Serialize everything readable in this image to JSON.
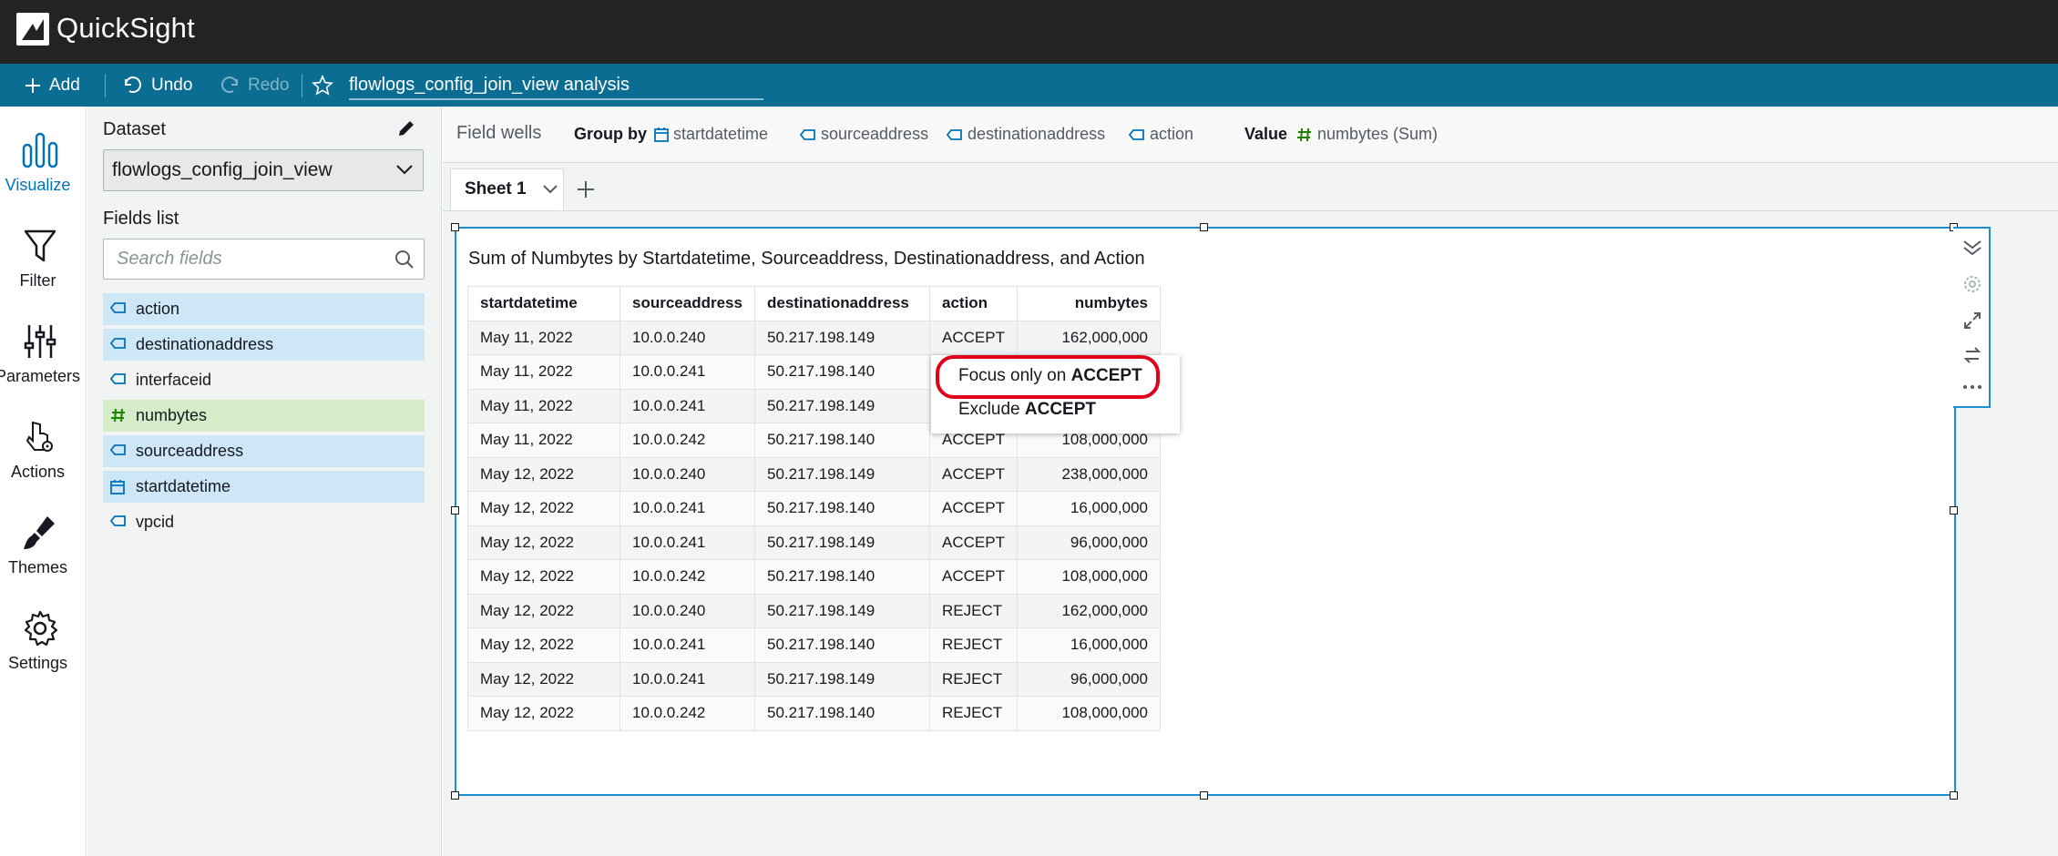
{
  "app": {
    "name": "QuickSight"
  },
  "toolbar": {
    "add_label": "Add",
    "undo_label": "Undo",
    "redo_label": "Redo",
    "analysis_title": "flowlogs_config_join_view analysis"
  },
  "rail": {
    "items": [
      {
        "label": "Visualize",
        "icon": "bar-chart-icon",
        "active": true
      },
      {
        "label": "Filter",
        "icon": "filter-icon"
      },
      {
        "label": "Parameters",
        "icon": "sliders-icon"
      },
      {
        "label": "Actions",
        "icon": "pointer-gear-icon"
      },
      {
        "label": "Themes",
        "icon": "brush-icon"
      },
      {
        "label": "Settings",
        "icon": "gear-icon"
      }
    ]
  },
  "data_panel": {
    "dataset_label": "Dataset",
    "dataset_value": "flowlogs_config_join_view",
    "fields_label": "Fields list",
    "search_placeholder": "Search fields",
    "fields": [
      {
        "name": "action",
        "type": "dimension",
        "selected": true
      },
      {
        "name": "destinationaddress",
        "type": "dimension",
        "selected": true
      },
      {
        "name": "interfaceid",
        "type": "dimension",
        "selected": false
      },
      {
        "name": "numbytes",
        "type": "measure",
        "selected": true
      },
      {
        "name": "sourceaddress",
        "type": "dimension",
        "selected": true
      },
      {
        "name": "startdatetime",
        "type": "date",
        "selected": true
      },
      {
        "name": "vpcid",
        "type": "dimension",
        "selected": false
      }
    ]
  },
  "field_wells": {
    "title": "Field wells",
    "group_by_label": "Group by",
    "group_by": [
      "startdatetime",
      "sourceaddress",
      "destinationaddress",
      "action"
    ],
    "value_label": "Value",
    "value": "numbytes (Sum)"
  },
  "sheet": {
    "tab_label": "Sheet 1"
  },
  "visual": {
    "title": "Sum of Numbytes by Startdatetime, Sourceaddress, Destinationaddress, and Action",
    "columns": [
      "startdatetime",
      "sourceaddress",
      "destinationaddress",
      "action",
      "numbytes"
    ],
    "rows": [
      [
        "May 11, 2022",
        "10.0.0.240",
        "50.217.198.149",
        "ACCEPT",
        "162,000,000"
      ],
      [
        "May 11, 2022",
        "10.0.0.241",
        "50.217.198.140",
        "",
        ""
      ],
      [
        "May 11, 2022",
        "10.0.0.241",
        "50.217.198.149",
        "",
        ""
      ],
      [
        "May 11, 2022",
        "10.0.0.242",
        "50.217.198.140",
        "ACCEPT",
        "108,000,000"
      ],
      [
        "May 12, 2022",
        "10.0.0.240",
        "50.217.198.149",
        "ACCEPT",
        "238,000,000"
      ],
      [
        "May 12, 2022",
        "10.0.0.241",
        "50.217.198.140",
        "ACCEPT",
        "16,000,000"
      ],
      [
        "May 12, 2022",
        "10.0.0.241",
        "50.217.198.149",
        "ACCEPT",
        "96,000,000"
      ],
      [
        "May 12, 2022",
        "10.0.0.242",
        "50.217.198.140",
        "ACCEPT",
        "108,000,000"
      ],
      [
        "May 12, 2022",
        "10.0.0.240",
        "50.217.198.149",
        "REJECT",
        "162,000,000"
      ],
      [
        "May 12, 2022",
        "10.0.0.241",
        "50.217.198.140",
        "REJECT",
        "16,000,000"
      ],
      [
        "May 12, 2022",
        "10.0.0.241",
        "50.217.198.149",
        "REJECT",
        "96,000,000"
      ],
      [
        "May 12, 2022",
        "10.0.0.242",
        "50.217.198.140",
        "REJECT",
        "108,000,000"
      ]
    ]
  },
  "context_menu": {
    "focus_prefix": "Focus only on ",
    "focus_value": "ACCEPT",
    "exclude_prefix": "Exclude ",
    "exclude_value": "ACCEPT"
  },
  "colors": {
    "header": "#232323",
    "toolbar": "#0c6d93",
    "accent": "#0073bb",
    "dimension_chip": "#cde7f6",
    "measure_chip": "#d5ecc8",
    "highlight": "#e3001b"
  }
}
